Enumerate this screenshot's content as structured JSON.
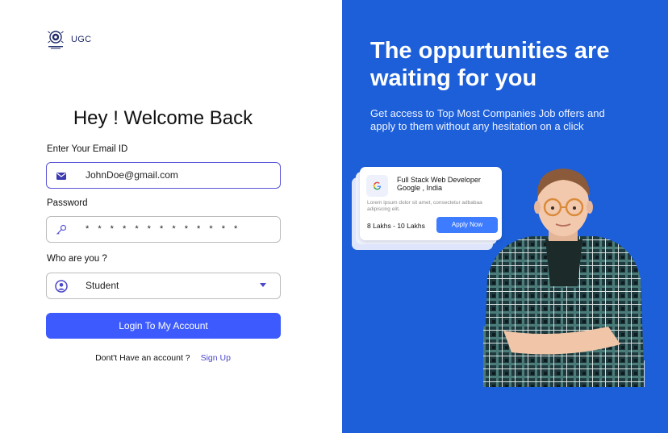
{
  "brand": {
    "name": "UGC",
    "logo": "ugc-emblem-icon"
  },
  "login": {
    "title": "Hey ! Welcome Back",
    "email_label": "Enter Your Email ID",
    "email_value": "JohnDoe@gmail.com",
    "email_icon": "mail-icon",
    "password_label": "Password",
    "password_value": "* * * * * * * * * * * * *",
    "password_icon": "key-icon",
    "role_label": "Who are you ?",
    "role_value": "Student",
    "role_icon": "user-circle-icon",
    "submit_label": "Login To My Account",
    "no_account_text": "Dont't Have an account ?",
    "signup_link": "Sign Up"
  },
  "promo": {
    "headline": "The oppurtunities are waiting for you",
    "subtext": "Get access to Top Most Companies Job offers and apply to them without any hesitation on a click",
    "job_card": {
      "company_icon": "google-icon",
      "title": "Full Stack Web Developer",
      "location": "Google , India",
      "description": "Lorem ipsum dolor sit amet, consectetur adbabaa adipiscing elit.",
      "salary": "8 Lakhs - 10 Lakhs",
      "apply_label": "Apply Now"
    }
  },
  "colors": {
    "primary_button": "#3d5afe",
    "right_panel_bg": "#1c5fd9",
    "link": "#4b47c9",
    "active_field_border": "#5a55d6"
  }
}
